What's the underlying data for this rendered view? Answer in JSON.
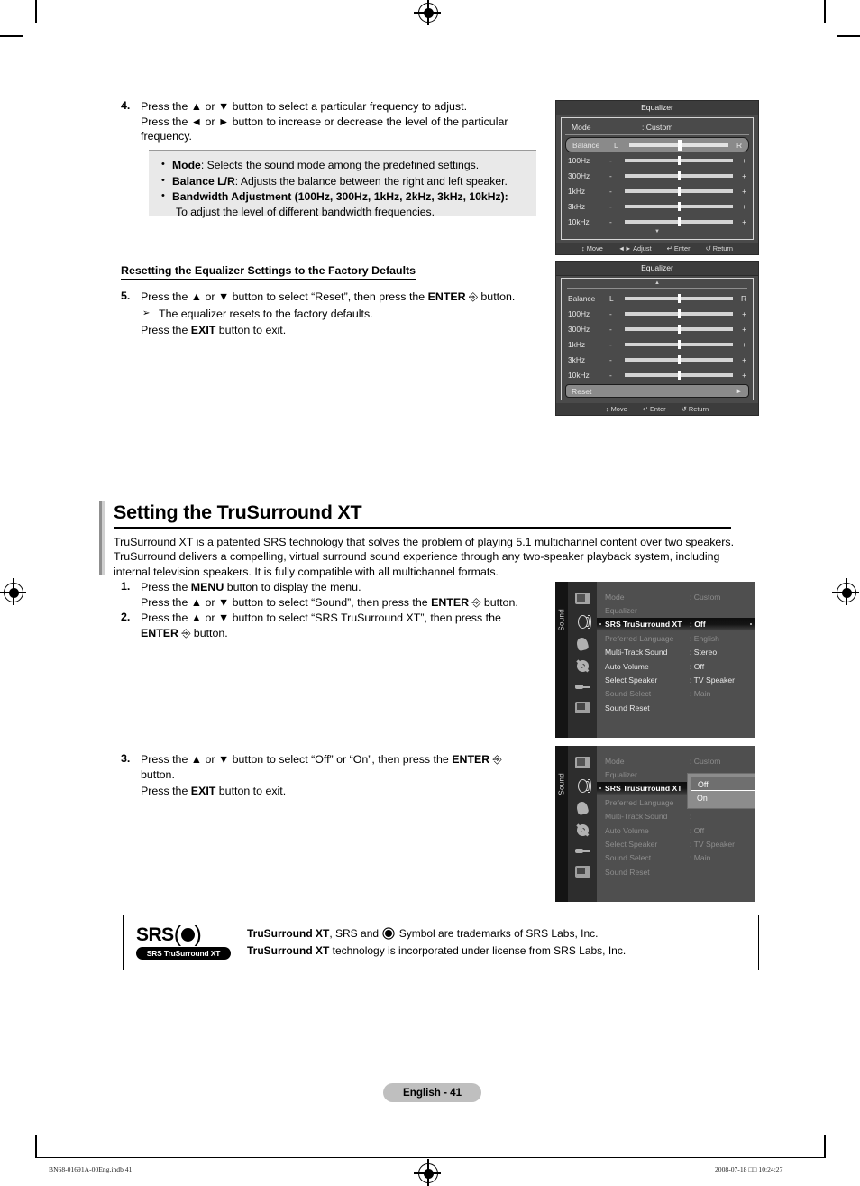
{
  "step4": {
    "num": "4.",
    "line1": "Press the ▲ or ▼ button to select a particular frequency to adjust.",
    "line2": "Press the ◄ or ► button to increase or decrease the level of the particular",
    "line3": "frequency."
  },
  "notebox": {
    "items": [
      {
        "bold": "Mode",
        "rest": ": Selects the sound mode among the predefined settings."
      },
      {
        "bold": "Balance L/R",
        "rest": ": Adjusts the balance between the right and left speaker."
      },
      {
        "bold": "Bandwidth Adjustment (100Hz, 300Hz, 1kHz, 2kHz, 3kHz, 10kHz):",
        "rest": "",
        "sub": "To adjust the level of different bandwidth frequencies."
      }
    ]
  },
  "subhead": "Resetting the Equalizer Settings to the Factory Defaults",
  "step5": {
    "num": "5.",
    "line1_a": "Press the ▲ or ▼ button to select “Reset”, then press the ",
    "line1_b": "ENTER",
    "line1_c": " button.",
    "bullet": "➢",
    "line2": "The equalizer resets to the factory defaults.",
    "line3_a": "Press the ",
    "line3_b": "EXIT",
    "line3_c": " button to exit."
  },
  "equalizer1": {
    "title": "Equalizer",
    "mode_label": "Mode",
    "mode_value": ": Custom",
    "rows": [
      {
        "label": "Balance",
        "left": "L",
        "right": "R",
        "pos": 50,
        "selected": true
      },
      {
        "label": "100Hz",
        "left": "-",
        "right": "+",
        "pos": 50,
        "selected": false
      },
      {
        "label": "300Hz",
        "left": "-",
        "right": "+",
        "pos": 50,
        "selected": false
      },
      {
        "label": "1kHz",
        "left": "-",
        "right": "+",
        "pos": 50,
        "selected": false
      },
      {
        "label": "3kHz",
        "left": "-",
        "right": "+",
        "pos": 50,
        "selected": false
      },
      {
        "label": "10kHz",
        "left": "-",
        "right": "+",
        "pos": 50,
        "selected": false
      }
    ],
    "scroll_down": "▼",
    "hints": [
      "↕ Move",
      "◄► Adjust",
      "↵ Enter",
      "↺ Return"
    ]
  },
  "equalizer2": {
    "title": "Equalizer",
    "scroll_up": "▲",
    "rows": [
      {
        "label": "Balance",
        "left": "L",
        "right": "R",
        "pos": 50,
        "selected": false
      },
      {
        "label": "100Hz",
        "left": "-",
        "right": "+",
        "pos": 50,
        "selected": false
      },
      {
        "label": "300Hz",
        "left": "-",
        "right": "+",
        "pos": 50,
        "selected": false
      },
      {
        "label": "1kHz",
        "left": "-",
        "right": "+",
        "pos": 50,
        "selected": false
      },
      {
        "label": "3kHz",
        "left": "-",
        "right": "+",
        "pos": 50,
        "selected": false
      },
      {
        "label": "10kHz",
        "left": "-",
        "right": "+",
        "pos": 50,
        "selected": false
      }
    ],
    "reset_label": "Reset",
    "reset_arrow": "►",
    "hints": [
      "↕ Move",
      "↵ Enter",
      "↺ Return"
    ]
  },
  "section": {
    "title": "Setting the TruSurround XT",
    "body": "TruSurround XT is a patented SRS technology that solves the problem of playing 5.1 multichannel content over two speakers. TruSurround delivers a compelling, virtual surround sound experience through any two-speaker playback system, including internal television speakers. It is fully compatible with all multichannel formats."
  },
  "step1": {
    "num": "1.",
    "line1_a": "Press the ",
    "line1_b": "MENU",
    "line1_c": " button to display the menu.",
    "line2_a": "Press the ▲ or ▼ button to select “Sound”, then press the ",
    "line2_b": "ENTER",
    "line2_c": " button."
  },
  "step2": {
    "num": "2.",
    "line1": "Press the ▲ or ▼ button to select “SRS TruSurround XT”, then press the",
    "line2_b": "ENTER",
    "line2_c": " button."
  },
  "step3": {
    "num": "3.",
    "line1_a": "Press the ▲ or ▼ button to select “Off” or “On”, then press the ",
    "line1_b": "ENTER",
    "line2": "button.",
    "line3_a": "Press the ",
    "line3_b": "EXIT",
    "line3_c": " button to exit."
  },
  "sound_menu_1": {
    "rail_label": "Sound",
    "icons": [
      "tv-icon",
      "speaker-icon",
      "hand-icon",
      "gear-icon",
      "plug-icon",
      "setup-icon"
    ],
    "rows": [
      {
        "label": "Mode",
        "value": ": Custom",
        "dim": true,
        "selected": false
      },
      {
        "label": "Equalizer",
        "value": "",
        "dim": true,
        "selected": false
      },
      {
        "label": "SRS TruSurround XT",
        "value": ": Off",
        "dim": false,
        "selected": true
      },
      {
        "label": "Preferred Language",
        "value": ": English",
        "dim": true,
        "selected": false
      },
      {
        "label": "Multi-Track Sound",
        "value": ": Stereo",
        "dim": false,
        "selected": false
      },
      {
        "label": "Auto Volume",
        "value": ": Off",
        "dim": false,
        "selected": false
      },
      {
        "label": "Select Speaker",
        "value": ": TV Speaker",
        "dim": false,
        "selected": false
      },
      {
        "label": "Sound Select",
        "value": ": Main",
        "dim": true,
        "selected": false
      },
      {
        "label": "Sound Reset",
        "value": "",
        "dim": false,
        "selected": false
      }
    ]
  },
  "sound_menu_2": {
    "rail_label": "Sound",
    "rows": [
      {
        "label": "Mode",
        "value": ": Custom",
        "dim": true,
        "selected": false
      },
      {
        "label": "Equalizer",
        "value": "",
        "dim": true,
        "selected": false
      },
      {
        "label": "SRS TruSurround XT",
        "value": ":",
        "dim": false,
        "selected": true
      },
      {
        "label": "Preferred Language",
        "value": ":",
        "dim": true,
        "selected": false
      },
      {
        "label": "Multi-Track Sound",
        "value": ":",
        "dim": true,
        "selected": false
      },
      {
        "label": "Auto Volume",
        "value": ": Off",
        "dim": true,
        "selected": false
      },
      {
        "label": "Select Speaker",
        "value": ": TV Speaker",
        "dim": true,
        "selected": false
      },
      {
        "label": "Sound Select",
        "value": ": Main",
        "dim": true,
        "selected": false
      },
      {
        "label": "Sound Reset",
        "value": "",
        "dim": true,
        "selected": false
      }
    ],
    "dropdown": {
      "options": [
        "Off",
        "On"
      ],
      "selected": "Off"
    }
  },
  "srs": {
    "logo_text": "SRS",
    "logo_badge": "SRS TruSurround XT",
    "line1_a": "TruSurround XT",
    "line1_b": ", SRS and ",
    "line1_c": " Symbol are trademarks of SRS Labs, Inc.",
    "line2_a": "TruSurround XT",
    "line2_b": " technology is incorporated under license from SRS Labs, Inc."
  },
  "page_number": "English - 41",
  "footer": {
    "left": "BN68-01691A-00Eng.indb   41",
    "right": "2008-07-18   □□ 10:24:27"
  }
}
